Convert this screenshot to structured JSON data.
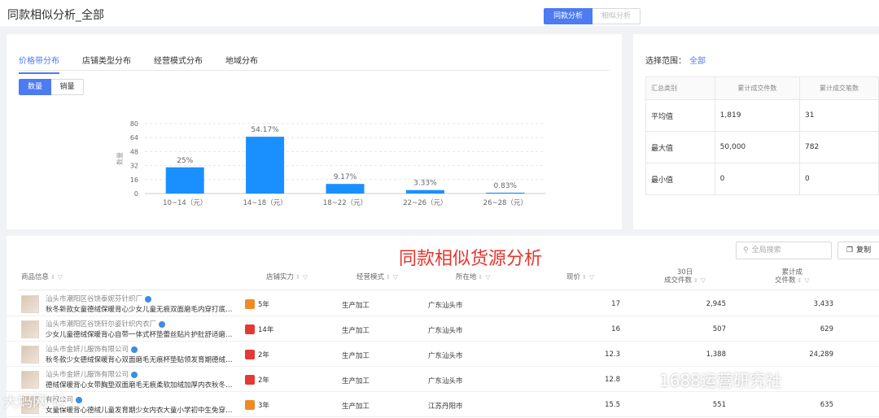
{
  "page": {
    "title": "同款相似分析_全部",
    "view_tabs": [
      "同款分析",
      "相似分析"
    ]
  },
  "distribution": {
    "tabs": [
      "价格带分布",
      "店铺类型分布",
      "经营模式分布",
      "地域分布"
    ],
    "toggle": [
      "数量",
      "销量"
    ]
  },
  "chart_data": {
    "type": "bar",
    "categories": [
      "10~14（元）",
      "14~18（元）",
      "18~22（元）",
      "22~26（元）",
      "26~28（元）"
    ],
    "values": [
      30,
      65,
      11,
      4,
      1
    ],
    "data_labels": [
      "25%",
      "54.17%",
      "9.17%",
      "3.33%",
      "0.83%"
    ],
    "yticks": [
      0,
      16,
      32,
      48,
      64,
      80
    ],
    "ylim": [
      0,
      80
    ],
    "ylabel": "数量",
    "grid": true,
    "bar_color": "#1a90ff"
  },
  "summary": {
    "scope_label": "选择范围：",
    "scope_value": "全部",
    "headers": [
      "汇总类别",
      "累计成交件数",
      "累计成交笔数"
    ],
    "rows": [
      [
        "平均值",
        "1,819",
        "31"
      ],
      [
        "最大值",
        "50,000",
        "782"
      ],
      [
        "最小值",
        "0",
        "0"
      ]
    ]
  },
  "sources": {
    "overlay_title": "同款相似货源分析",
    "search_placeholder": "全局搜索",
    "copy_label": "复制",
    "headers": {
      "product": "商品信息",
      "shop_level": "店铺实力",
      "mode": "经营模式",
      "location": "所在地",
      "price": "现价",
      "sales30_l1": "30日",
      "sales30_l2": "成交件数",
      "total_l1": "累计成",
      "total_l2": "交件数"
    },
    "rows": [
      {
        "shop": "汕头市潮阳区谷饶泰妮芬针织厂",
        "name": "秋冬新款女童德绒保暖背心少女儿童无痕双面磨毛内穿打底…",
        "years": "5年",
        "badge": "#f08a24",
        "mode": "生产加工",
        "location": "广东汕头市",
        "price": "17",
        "sales30": "2,945",
        "total": "3,433"
      },
      {
        "shop": "汕头市潮阳区谷饶轩尔姿针织内衣厂",
        "name": "少女儿童德绒保暖背心自带一体式杯垫蕾丝贴片护肚舒适磨…",
        "years": "14年",
        "badge": "#e53935",
        "mode": "生产加工",
        "location": "广东汕头市",
        "price": "16",
        "sales30": "507",
        "total": "629"
      },
      {
        "shop": "汕头市金妍儿服饰有限公司",
        "name": "秋冬款少女德绒保暖背心双面磨毛无痕杯垫贴领发育期德绒…",
        "years": "2年",
        "badge": "#e53935",
        "mode": "生产加工",
        "location": "广东汕头市",
        "price": "12.3",
        "sales30": "1,388",
        "total": "24,289"
      },
      {
        "shop": "汕头市金妍儿服饰有限公司",
        "name": "德绒保暖背心女带胸垫双面磨毛无痕柔软加绒加厚内衣秋冬…",
        "years": "2年",
        "badge": "#e53935",
        "mode": "生产加工",
        "location": "广东汕头市",
        "price": "12.8",
        "sales30": "",
        "total": ""
      },
      {
        "shop": "有限公司",
        "name": "女童保暖背心德绒儿童发育期少女内衣大童小学初中生免穿…",
        "years": "3年",
        "badge": "#f08a24",
        "mode": "生产加工",
        "location": "江苏丹阳市",
        "price": "15.5",
        "sales30": "551",
        "total": "635"
      }
    ]
  },
  "watermark": {
    "right": "1688运营研究社",
    "left": "大蚂网·社"
  }
}
